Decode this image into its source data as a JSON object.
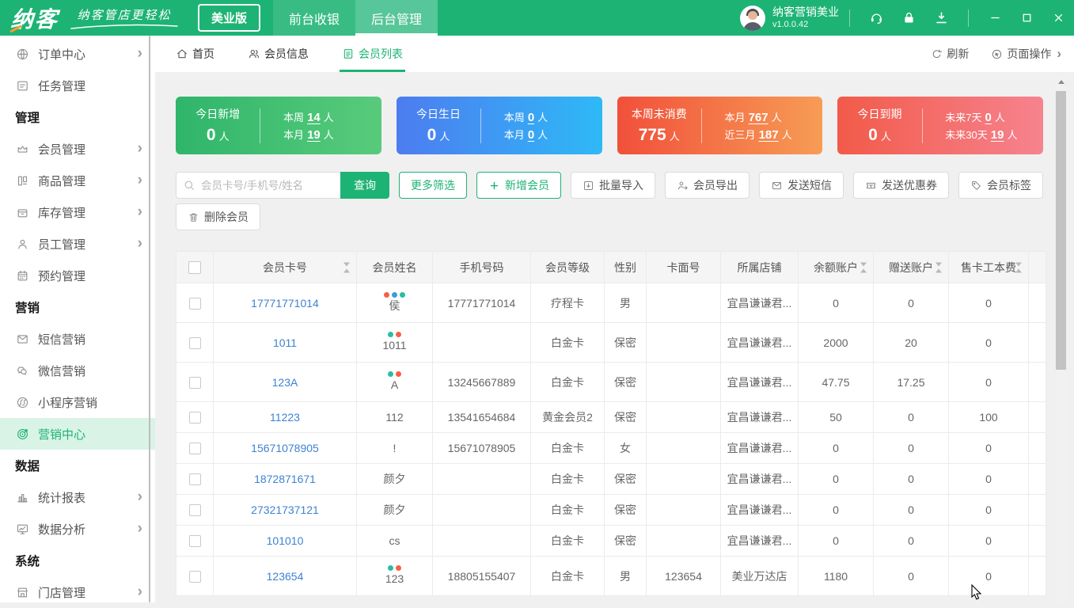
{
  "titlebar": {
    "logo_text": "纳客",
    "slogan": "纳客管店更轻松",
    "edition_button": "美业版",
    "nav_tabs": [
      {
        "label": "前台收银",
        "active": false
      },
      {
        "label": "后台管理",
        "active": true
      }
    ],
    "account_name": "纳客营销美业",
    "version": "v1.0.0.42"
  },
  "page_tabs": {
    "items": [
      {
        "label": "首页",
        "icon": "home",
        "active": false
      },
      {
        "label": "会员信息",
        "icon": "members",
        "active": false
      },
      {
        "label": "会员列表",
        "icon": "list",
        "active": true
      }
    ],
    "refresh_label": "刷新",
    "page_ops_label": "页面操作"
  },
  "sidebar": {
    "items": [
      {
        "type": "item",
        "label": "订单中心",
        "icon": "globe",
        "arrow": true
      },
      {
        "type": "item",
        "label": "任务管理",
        "icon": "task",
        "arrow": false
      },
      {
        "type": "section",
        "label": "管理"
      },
      {
        "type": "item",
        "label": "会员管理",
        "icon": "crown",
        "arrow": true
      },
      {
        "type": "item",
        "label": "商品管理",
        "icon": "goods",
        "arrow": true
      },
      {
        "type": "item",
        "label": "库存管理",
        "icon": "inventory",
        "arrow": true
      },
      {
        "type": "item",
        "label": "员工管理",
        "icon": "staff",
        "arrow": true
      },
      {
        "type": "item",
        "label": "预约管理",
        "icon": "calendar",
        "arrow": false
      },
      {
        "type": "section",
        "label": "营销"
      },
      {
        "type": "item",
        "label": "短信营销",
        "icon": "sms",
        "arrow": false
      },
      {
        "type": "item",
        "label": "微信营销",
        "icon": "wechat",
        "arrow": false
      },
      {
        "type": "item",
        "label": "小程序营销",
        "icon": "miniapp",
        "arrow": false
      },
      {
        "type": "item",
        "label": "营销中心",
        "icon": "target",
        "arrow": false,
        "active": true
      },
      {
        "type": "section",
        "label": "数据"
      },
      {
        "type": "item",
        "label": "统计报表",
        "icon": "chart",
        "arrow": true
      },
      {
        "type": "item",
        "label": "数据分析",
        "icon": "analysis",
        "arrow": true
      },
      {
        "type": "section",
        "label": "系统"
      },
      {
        "type": "item",
        "label": "门店管理",
        "icon": "store",
        "arrow": true
      }
    ]
  },
  "stat_cards": [
    {
      "title": "今日新增",
      "value": "0",
      "unit": "人",
      "rows": [
        {
          "label": "本周",
          "num": "14",
          "unit": "人"
        },
        {
          "label": "本月",
          "num": "19",
          "unit": "人"
        }
      ],
      "gradient": [
        "#2fb56b",
        "#58cb7b"
      ]
    },
    {
      "title": "今日生日",
      "value": "0",
      "unit": "人",
      "rows": [
        {
          "label": "本周",
          "num": "0",
          "unit": "人"
        },
        {
          "label": "本月",
          "num": "0",
          "unit": "人"
        }
      ],
      "gradient": [
        "#4d7cf0",
        "#2eb9f6"
      ]
    },
    {
      "title": "本周未消费",
      "value": "775",
      "unit": "人",
      "rows": [
        {
          "label": "本月",
          "num": "767",
          "unit": "人"
        },
        {
          "label": "近三月",
          "num": "187",
          "unit": "人"
        }
      ],
      "gradient": [
        "#f1503a",
        "#f79c55"
      ]
    },
    {
      "title": "今日到期",
      "value": "0",
      "unit": "人",
      "rows": [
        {
          "label": "未来7天",
          "num": "0",
          "unit": "人"
        },
        {
          "label": "未来30天",
          "num": "19",
          "unit": "人"
        }
      ],
      "gradient": [
        "#f25a49",
        "#f6838f"
      ]
    }
  ],
  "toolbar": {
    "search_placeholder": "会员卡号/手机号/姓名",
    "search_button": "查询",
    "buttons": [
      {
        "label": "更多筛选",
        "style": "oline",
        "icon": ""
      },
      {
        "label": "新增会员",
        "style": "oline",
        "icon": "plus"
      },
      {
        "label": "批量导入",
        "style": "default",
        "icon": "import"
      },
      {
        "label": "会员导出",
        "style": "default",
        "icon": "export"
      },
      {
        "label": "发送短信",
        "style": "default",
        "icon": "sms"
      },
      {
        "label": "发送优惠券",
        "style": "default",
        "icon": "coupon"
      },
      {
        "label": "会员标签",
        "style": "default",
        "icon": "tag"
      }
    ],
    "delete_button": {
      "label": "删除会员",
      "icon": "trash"
    }
  },
  "table": {
    "columns": [
      {
        "label": "",
        "key": "checkbox",
        "sortable": false
      },
      {
        "label": "会员卡号",
        "sortable": true
      },
      {
        "label": "会员姓名",
        "sortable": false
      },
      {
        "label": "手机号码",
        "sortable": false
      },
      {
        "label": "会员等级",
        "sortable": false
      },
      {
        "label": "性别",
        "sortable": false
      },
      {
        "label": "卡面号",
        "sortable": false
      },
      {
        "label": "所属店铺",
        "sortable": false
      },
      {
        "label": "余额账户",
        "sortable": true
      },
      {
        "label": "赠送账户",
        "sortable": true
      },
      {
        "label": "售卡工本费",
        "sortable": true
      }
    ],
    "rows": [
      {
        "card_no": "17771771014",
        "name": "侯",
        "dots": [
          "#f4604a",
          "#3e9bd8",
          "#2abda1"
        ],
        "phone": "17771771014",
        "level": "疗程卡",
        "gender": "男",
        "card_face": "",
        "store": "宜昌谦谦君...",
        "balance": "0",
        "gift": "0",
        "fee": "0"
      },
      {
        "card_no": "1011",
        "name": "1011",
        "dots": [
          "#2abda1",
          "#f4604a"
        ],
        "phone": "",
        "level": "白金卡",
        "gender": "保密",
        "card_face": "",
        "store": "宜昌谦谦君...",
        "balance": "2000",
        "gift": "20",
        "fee": "0"
      },
      {
        "card_no": "123A",
        "name": "A",
        "dots": [
          "#2abda1",
          "#f4604a"
        ],
        "phone": "13245667889",
        "level": "白金卡",
        "gender": "保密",
        "card_face": "",
        "store": "宜昌谦谦君...",
        "balance": "47.75",
        "gift": "17.25",
        "fee": "0"
      },
      {
        "card_no": "11223",
        "name": "112",
        "dots": [],
        "phone": "13541654684",
        "level": "黄金会员2",
        "gender": "保密",
        "card_face": "",
        "store": "宜昌谦谦君...",
        "balance": "50",
        "gift": "0",
        "fee": "100"
      },
      {
        "card_no": "15671078905",
        "name": "!",
        "dots": [],
        "phone": "15671078905",
        "level": "白金卡",
        "gender": "女",
        "card_face": "",
        "store": "宜昌谦谦君...",
        "balance": "0",
        "gift": "0",
        "fee": "0"
      },
      {
        "card_no": "1872871671",
        "name": "颜夕",
        "dots": [],
        "phone": "",
        "level": "白金卡",
        "gender": "保密",
        "card_face": "",
        "store": "宜昌谦谦君...",
        "balance": "0",
        "gift": "0",
        "fee": "0"
      },
      {
        "card_no": "27321737121",
        "name": "颜夕",
        "dots": [],
        "phone": "",
        "level": "白金卡",
        "gender": "保密",
        "card_face": "",
        "store": "宜昌谦谦君...",
        "balance": "0",
        "gift": "0",
        "fee": "0"
      },
      {
        "card_no": "101010",
        "name": "cs",
        "dots": [],
        "phone": "",
        "level": "白金卡",
        "gender": "保密",
        "card_face": "",
        "store": "宜昌谦谦君...",
        "balance": "0",
        "gift": "0",
        "fee": "0"
      },
      {
        "card_no": "123654",
        "name": "123",
        "dots": [
          "#2abda1",
          "#f4604a"
        ],
        "phone": "18805155407",
        "level": "白金卡",
        "gender": "男",
        "card_face": "123654",
        "store": "美业万达店",
        "balance": "1180",
        "gift": "0",
        "fee": "0"
      }
    ]
  },
  "colors": {
    "brand_green": "#1db374",
    "link_blue": "#3e82d2",
    "content_bg": "#f0f0f0",
    "active_item_bg": "#d9f3e7"
  }
}
